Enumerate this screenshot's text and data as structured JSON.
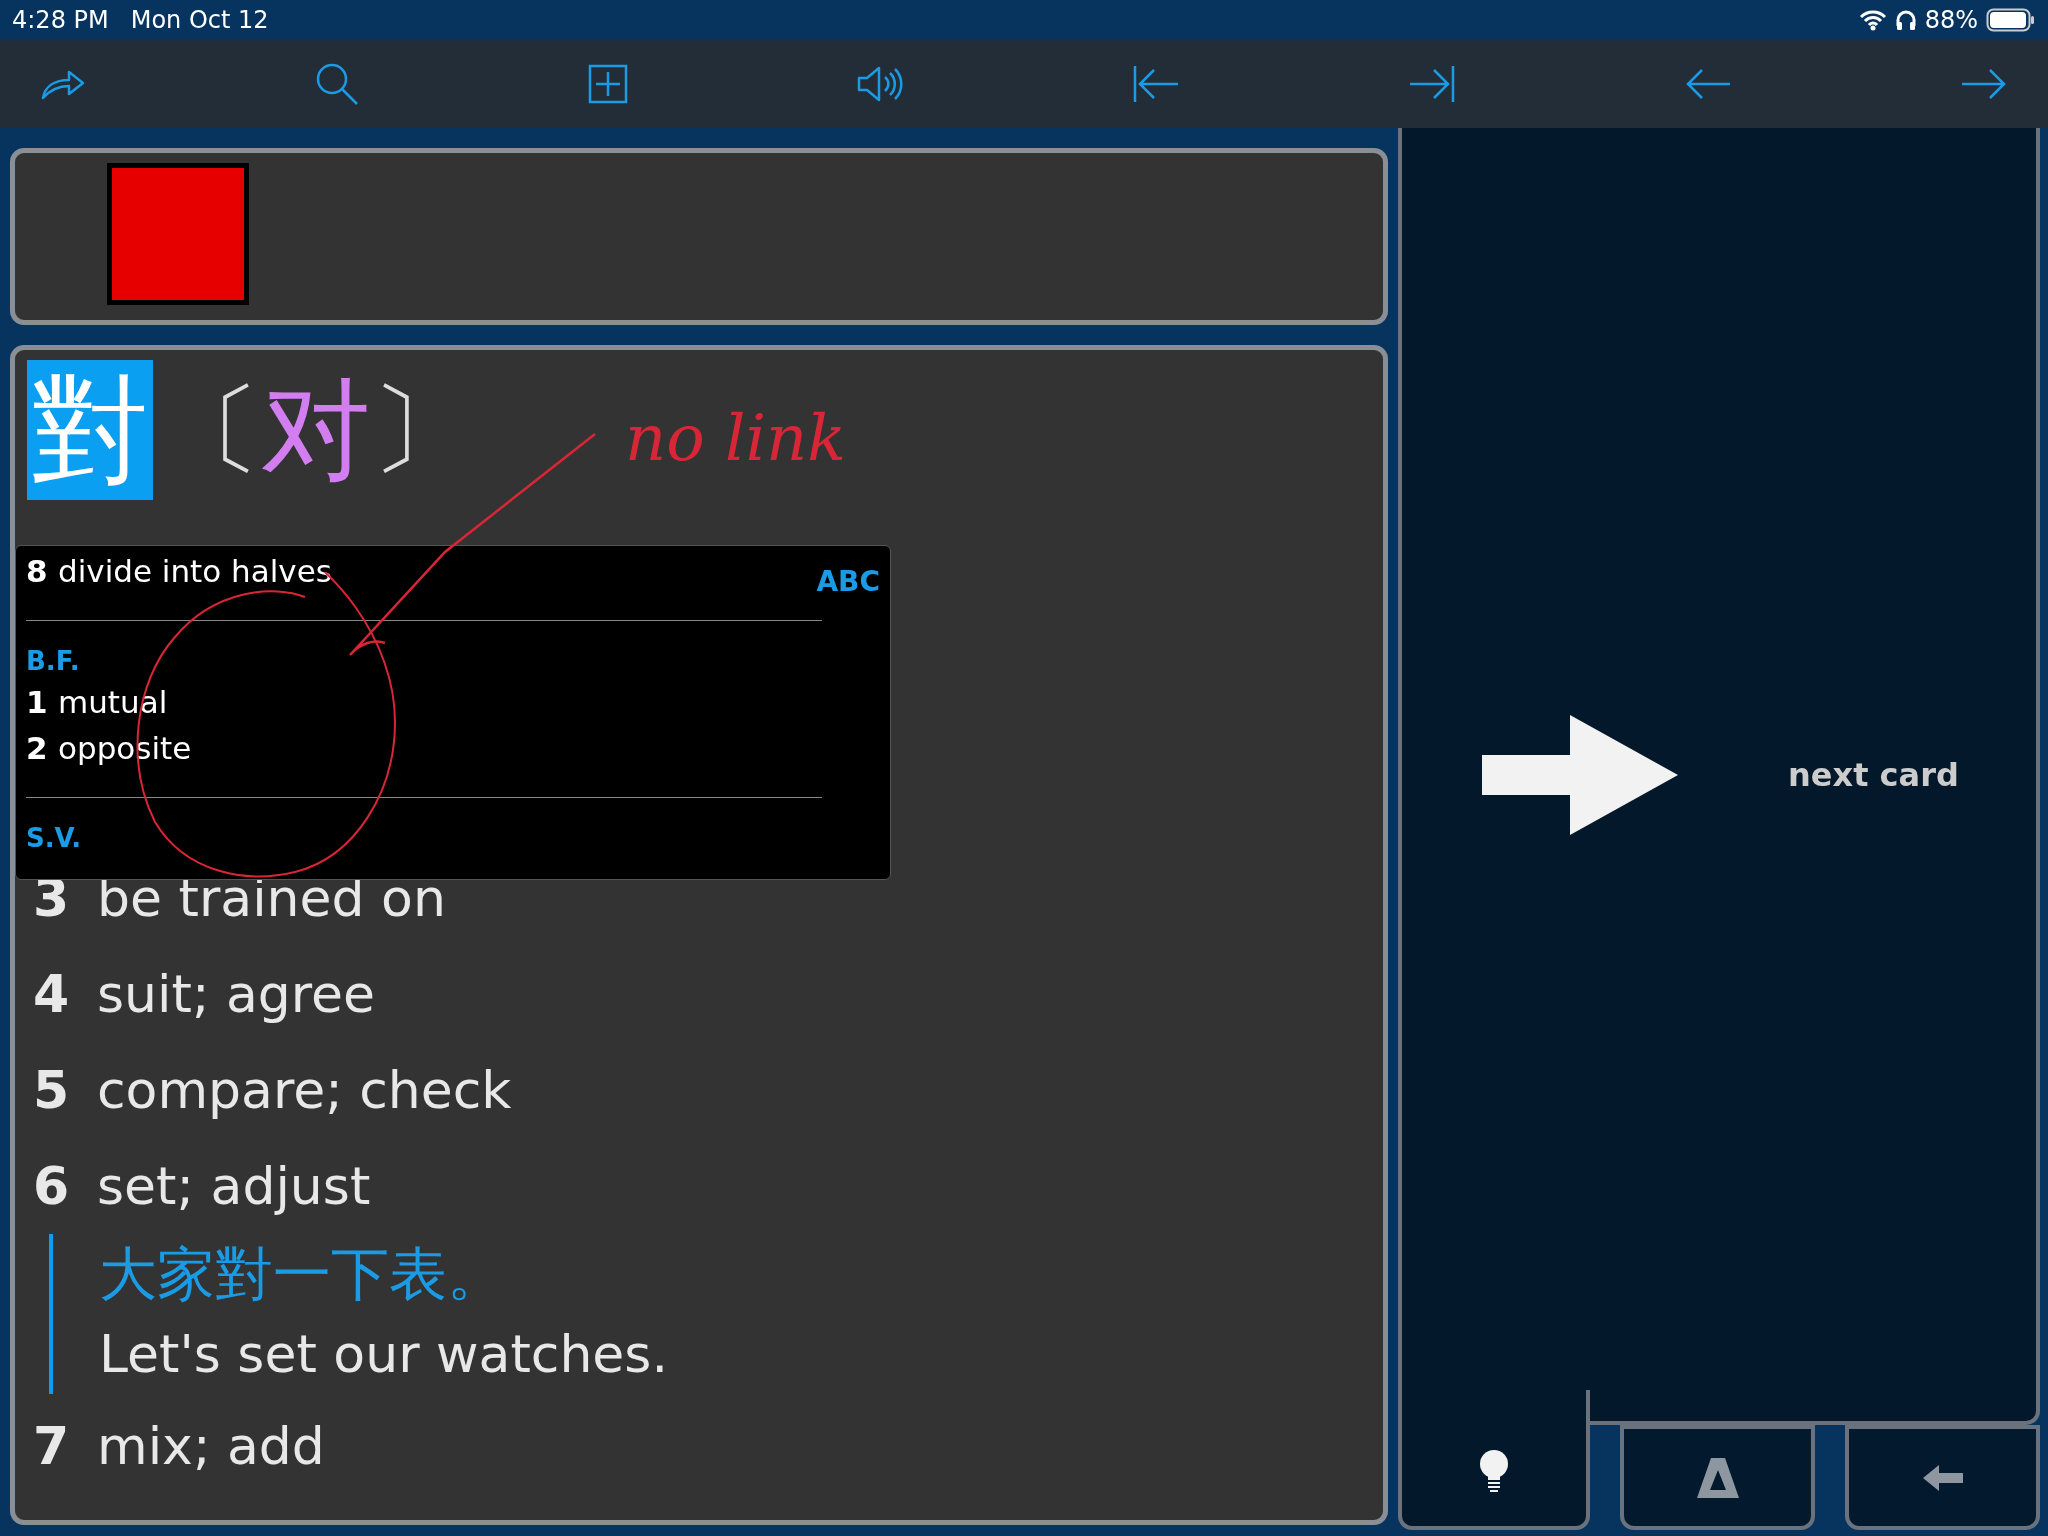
{
  "status_bar": {
    "time": "4:28 PM",
    "date": "Mon Oct 12",
    "battery": "88%"
  },
  "entry": {
    "headword": "對",
    "bracket_open": "〔",
    "simplified": "对",
    "bracket_close": "〕",
    "selected": true
  },
  "popup": {
    "label": "ABC",
    "lines": [
      {
        "kind": "sense",
        "number": "8",
        "text": "divide into halves"
      },
      {
        "kind": "divider"
      },
      {
        "kind": "heading",
        "text": "B.F."
      },
      {
        "kind": "sense",
        "number": "1",
        "text": "mutual"
      },
      {
        "kind": "sense",
        "number": "2",
        "text": "opposite"
      },
      {
        "kind": "divider"
      },
      {
        "kind": "heading",
        "text": "S.V."
      }
    ]
  },
  "senses": [
    {
      "number": "3",
      "text": "be trained on"
    },
    {
      "number": "4",
      "text": "suit; agree"
    },
    {
      "number": "5",
      "text": "compare; check"
    },
    {
      "number": "6",
      "text": "set; adjust",
      "example": {
        "chinese": "大家對一下表。",
        "english": "Let's set our watches."
      }
    },
    {
      "number": "7",
      "text": "mix; add"
    }
  ],
  "annotation": {
    "text": "no link"
  },
  "next_card": {
    "label": "next card"
  }
}
